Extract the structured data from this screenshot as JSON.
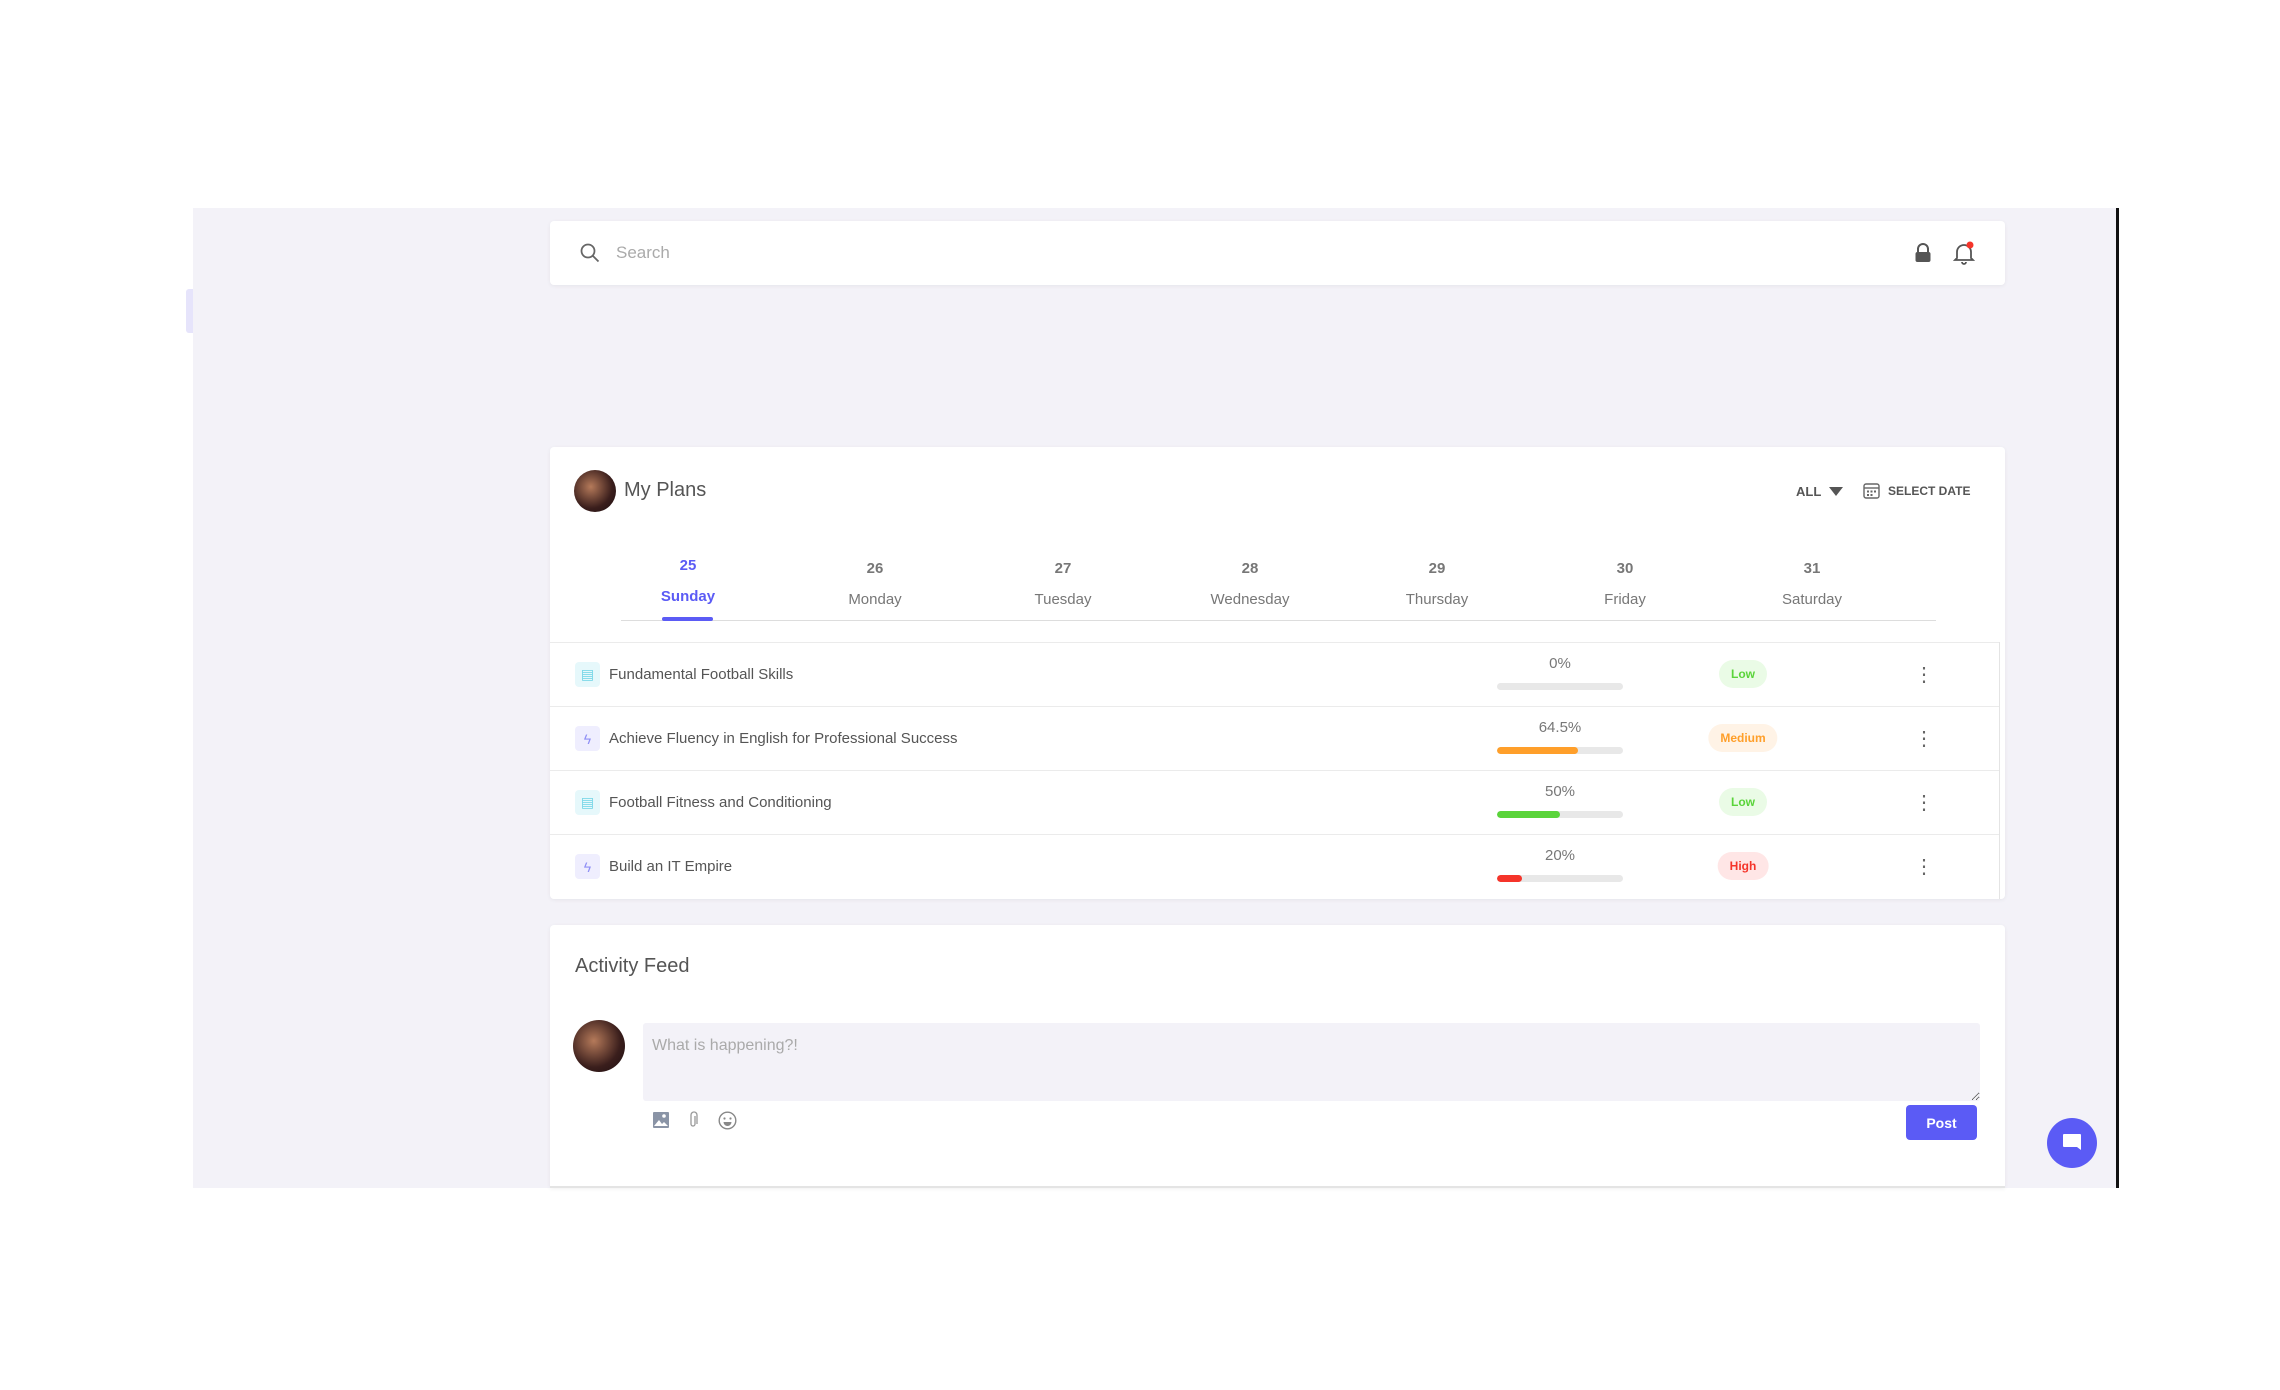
{
  "search": {
    "placeholder": "Search",
    "icons": [
      "search-icon",
      "lock-icon",
      "bell-icon"
    ]
  },
  "plans": {
    "title": "My Plans",
    "filter": "ALL",
    "select_date": "SELECT DATE",
    "days": [
      {
        "num": "25",
        "name": "Sunday",
        "active": true
      },
      {
        "num": "26",
        "name": "Monday"
      },
      {
        "num": "27",
        "name": "Tuesday"
      },
      {
        "num": "28",
        "name": "Wednesday"
      },
      {
        "num": "29",
        "name": "Thursday"
      },
      {
        "num": "30",
        "name": "Friday"
      },
      {
        "num": "31",
        "name": "Saturday"
      }
    ],
    "items": [
      {
        "title": "Fundamental Football Skills",
        "progress_label": "0%",
        "progress": 0,
        "priority": "Low",
        "icon": "list-icon"
      },
      {
        "title": "Achieve Fluency in English for Professional Success",
        "progress_label": "64.5%",
        "progress": 64.5,
        "priority": "Medium",
        "icon": "bolt-icon"
      },
      {
        "title": "Football Fitness and Conditioning",
        "progress_label": "50%",
        "progress": 50,
        "priority": "Low",
        "icon": "list-icon"
      },
      {
        "title": "Build an IT Empire",
        "progress_label": "20%",
        "progress": 20,
        "priority": "High",
        "icon": "bolt-icon"
      }
    ]
  },
  "activity": {
    "title": "Activity Feed",
    "placeholder": "What is happening?!",
    "post_label": "Post"
  },
  "colors": {
    "accent": "#5b5bf5",
    "low": "#5ad43a",
    "medium": "#ff9f2a",
    "high": "#f5342a"
  }
}
